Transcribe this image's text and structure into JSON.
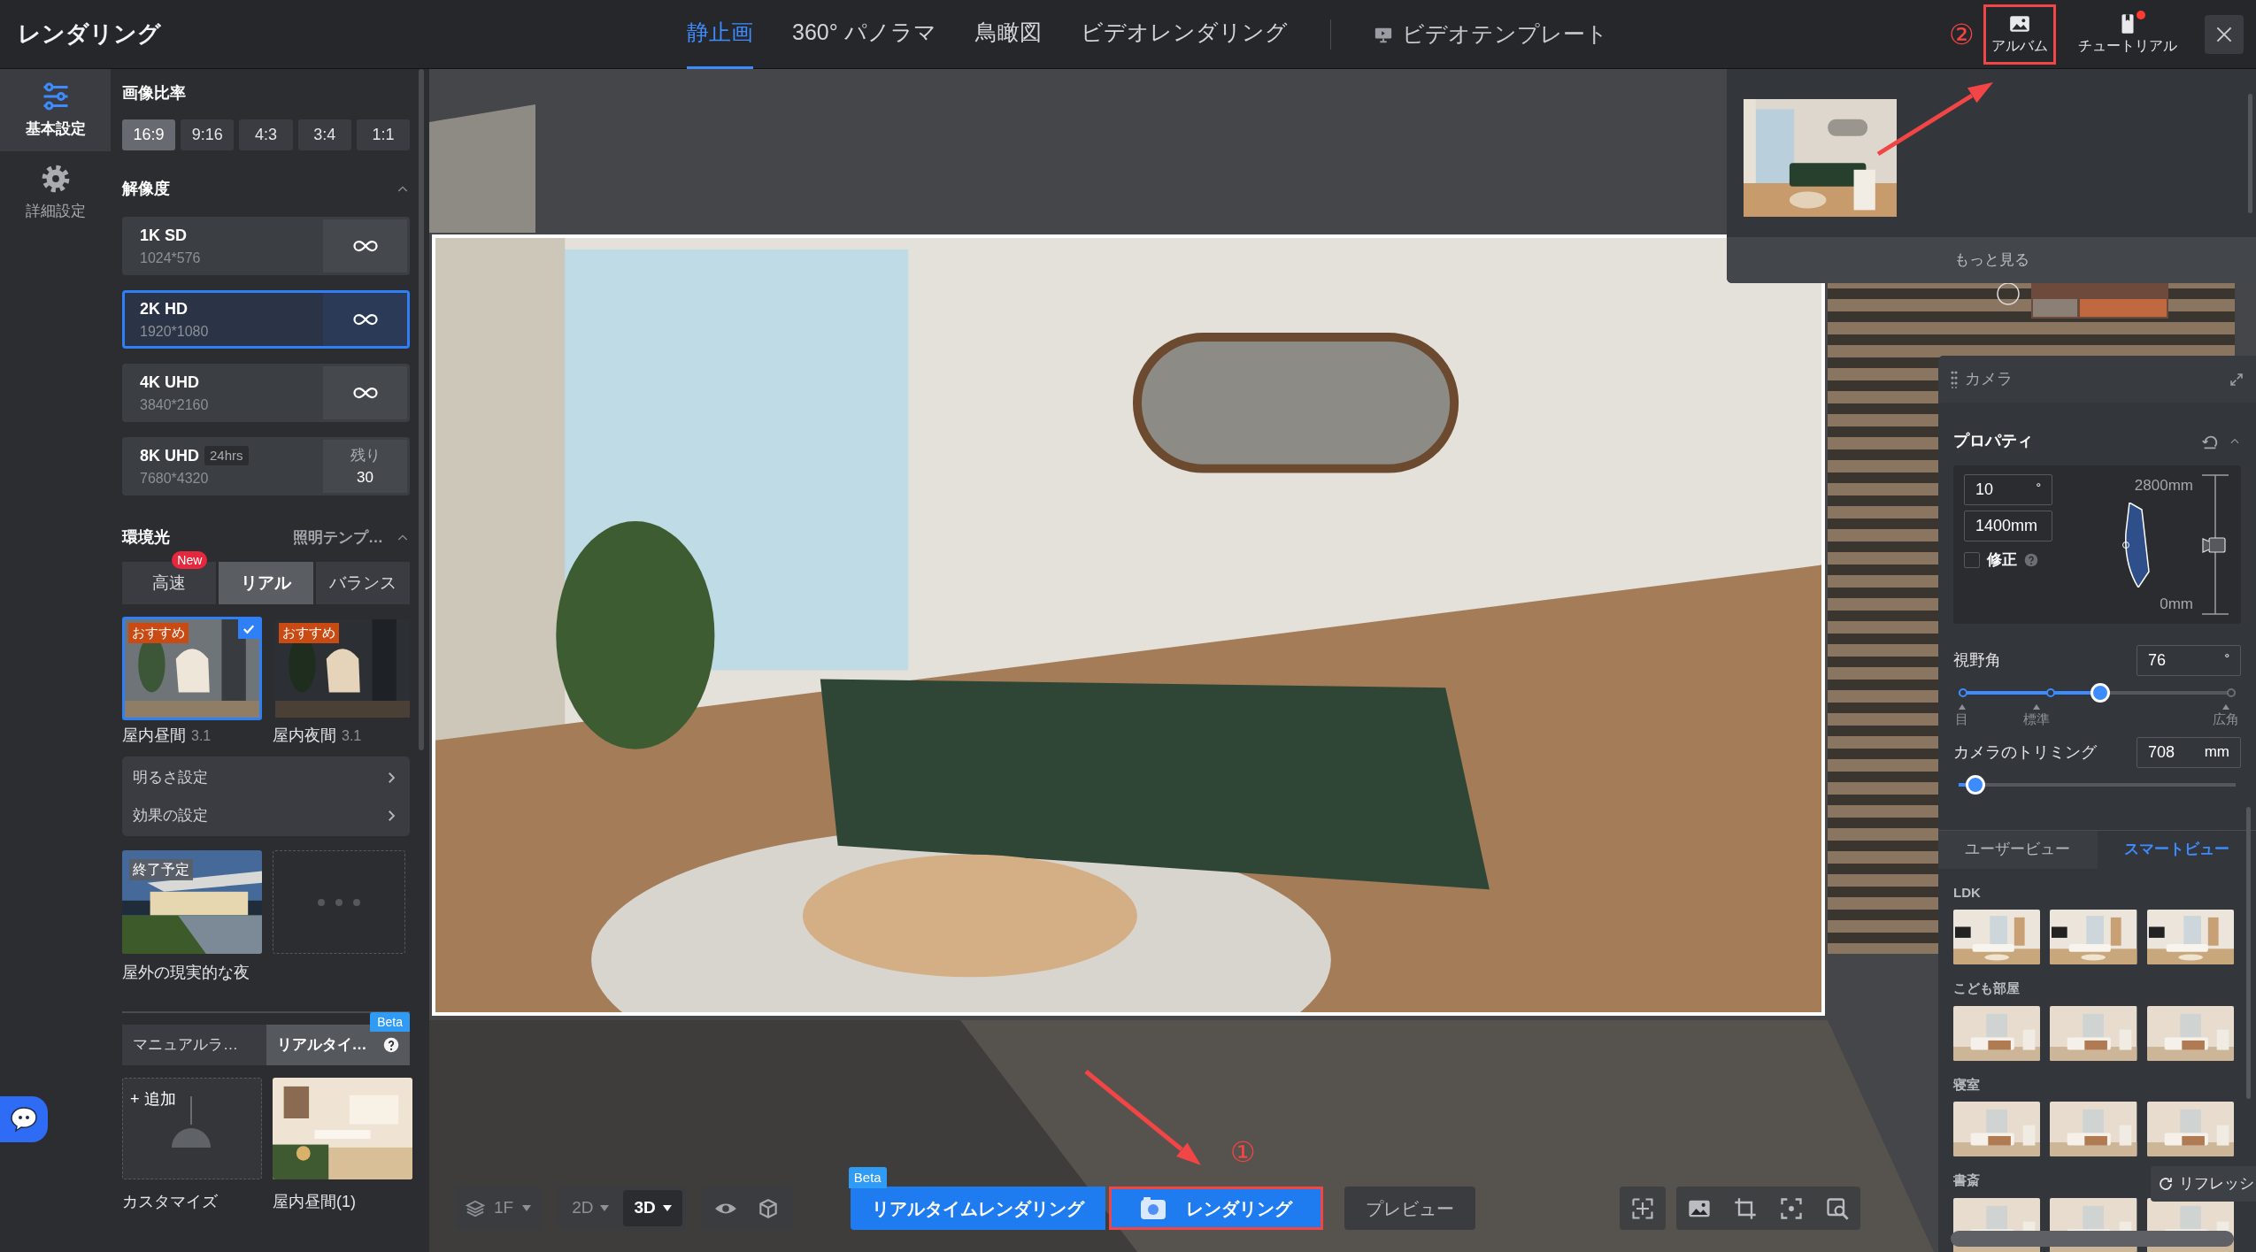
{
  "header": {
    "title": "レンダリング"
  },
  "mode_tabs": [
    {
      "label": "静止画",
      "selected": true
    },
    {
      "label": "360° パノラマ",
      "selected": false
    },
    {
      "label": "鳥瞰図",
      "selected": false
    },
    {
      "label": "ビデオレンダリング",
      "selected": false
    }
  ],
  "video_template": {
    "label": "ビデオテンプレート"
  },
  "top_actions": [
    {
      "kind": "album",
      "label": "アルバム",
      "step": "②",
      "highlighted": true,
      "badge": false
    },
    {
      "kind": "tutorial",
      "label": "チュートリアル",
      "highlighted": false,
      "badge": true
    }
  ],
  "side_nav": [
    {
      "kind": "basic",
      "label": "基本設定",
      "selected": true
    },
    {
      "kind": "advanced",
      "label": "詳細設定",
      "selected": false
    }
  ],
  "aspect_ratio": {
    "title": "画像比率",
    "options": [
      {
        "label": "16:9",
        "selected": true
      },
      {
        "label": "9:16",
        "selected": false
      },
      {
        "label": "4:3",
        "selected": false
      },
      {
        "label": "3:4",
        "selected": false
      },
      {
        "label": "1:1",
        "selected": false
      }
    ]
  },
  "resolution": {
    "title": "解像度",
    "expanded": true,
    "options": [
      {
        "name": "1K SD",
        "size": "1024*576",
        "kind": "unlimited",
        "selected": false
      },
      {
        "name": "2K HD",
        "size": "1920*1080",
        "kind": "unlimited",
        "selected": true
      },
      {
        "name": "4K UHD",
        "size": "3840*2160",
        "kind": "unlimited",
        "selected": false
      },
      {
        "name": "8K UHD",
        "tag": "24hrs",
        "size": "7680*4320",
        "kind": "limited",
        "remaining_label": "残り",
        "remaining": "30",
        "selected": false
      }
    ]
  },
  "lighting": {
    "title": "環境光",
    "template_link": "照明テンプ…",
    "expanded": true,
    "modes": [
      {
        "label": "高速",
        "badge": "New",
        "selected": false
      },
      {
        "label": "リアル",
        "selected": true
      },
      {
        "label": "バランス",
        "selected": false
      }
    ],
    "presets": [
      {
        "name": "屋内昼間",
        "version": "3.1",
        "tag": "おすすめ",
        "selected": true
      },
      {
        "name": "屋内夜間",
        "version": "3.1",
        "tag": "おすすめ",
        "selected": false
      }
    ],
    "settings": [
      "明るさ設定",
      "効果の設定"
    ],
    "more_presets": [
      {
        "name": "屋外の現実的な夜",
        "tag": "終了予定"
      }
    ]
  },
  "light_source": {
    "tabs": [
      {
        "label": "マニュアルラ…",
        "selected": false
      },
      {
        "label": "リアルタイ…",
        "badge": "Beta",
        "selected": true
      }
    ],
    "items": [
      {
        "kind": "add",
        "action": "+ 追加",
        "name": "カスタマイズ"
      },
      {
        "kind": "preset",
        "name": "屋内昼間(1)"
      }
    ]
  },
  "album": {
    "more": "もっと見る"
  },
  "camera": {
    "title": "カメラ",
    "properties": "プロパティ",
    "tilt": "10",
    "tilt_unit": "°",
    "height": "1400mm",
    "correction": {
      "label": "修正",
      "checked": false
    },
    "top": "2800mm",
    "bottom": "0mm",
    "fov": {
      "label": "視野角",
      "value": "76",
      "unit": "°",
      "level": 0.51,
      "marks": [
        "目",
        "標準",
        "広角"
      ]
    },
    "trim": {
      "label": "カメラのトリミング",
      "value": "708",
      "unit": "mm",
      "level": 0.06
    },
    "view_tabs": [
      {
        "label": "ユーザービュー",
        "selected": false
      },
      {
        "label": "スマートビュー",
        "selected": true
      }
    ],
    "groups": [
      {
        "name": "LDK"
      },
      {
        "name": "こども部屋"
      },
      {
        "name": "寝室"
      },
      {
        "name": "書斎"
      }
    ],
    "refresh": "リフレッシ"
  },
  "toolbar": {
    "floor": "1F",
    "views": [
      {
        "label": "2D",
        "selected": false
      },
      {
        "label": "3D",
        "selected": true
      }
    ],
    "realtime": {
      "label": "リアルタイムレンダリング",
      "badge": "Beta"
    },
    "render": {
      "label": "レンダリング",
      "step": "①",
      "highlighted": true
    },
    "preview": "プレビュー"
  }
}
